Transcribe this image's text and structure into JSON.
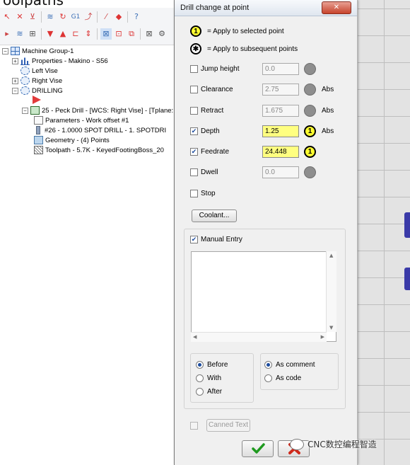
{
  "toolpaths": {
    "title": "oolpaths",
    "tree": [
      {
        "label": "Machine Group-1"
      },
      {
        "label": "Properties - Makino - S56"
      },
      {
        "label": "Left Vise"
      },
      {
        "label": "Right Vise"
      },
      {
        "label": "DRILLING"
      },
      {
        "label": "25 - Peck Drill - [WCS: Right Vise] - [Tplane:"
      },
      {
        "label": "Parameters - Work offset #1"
      },
      {
        "label": "#26 - 1.0000 SPOT DRILL - 1. SPOTDRI"
      },
      {
        "label": "Geometry - (4) Points"
      },
      {
        "label": "Toolpath - 5.7K - KeyedFootingBoss_20"
      }
    ],
    "toolbar_icons": [
      "select-icon",
      "deselect-icon",
      "filter-icon",
      "lock-icon",
      "regen-icon",
      "g1-icon",
      "post-icon",
      "help-icon",
      "toolpath-view-icon",
      "tool-icon",
      "move-down-icon",
      "move-up-icon",
      "insert-arrow-icon",
      "expand-icon",
      "select-all-icon",
      "copy-icon",
      "cut-icon",
      "tool-plane-icon",
      "gear-icon"
    ]
  },
  "dialog": {
    "title": "Drill change at point",
    "close_label": "✕",
    "legend": [
      {
        "symbol": "1",
        "text": "= Apply to selected point"
      },
      {
        "symbol": "✱",
        "text": "= Apply to subsequent points"
      }
    ],
    "params": [
      {
        "label": "Jump height",
        "value": "0.0",
        "checked": false,
        "abs": ""
      },
      {
        "label": "Clearance",
        "value": "2.75",
        "checked": false,
        "abs": "Abs"
      },
      {
        "label": "Retract",
        "value": "1.675",
        "checked": false,
        "abs": "Abs"
      },
      {
        "label": "Depth",
        "value": "1.25",
        "checked": true,
        "abs": "Abs"
      },
      {
        "label": "Feedrate",
        "value": "24.448",
        "checked": true,
        "abs": ""
      },
      {
        "label": "Dwell",
        "value": "0.0",
        "checked": false,
        "abs": ""
      }
    ],
    "stop_label": "Stop",
    "coolant_label": "Coolant...",
    "manual_entry_label": "Manual Entry",
    "manual_entry_value": "",
    "position_options": [
      "Before",
      "With",
      "After"
    ],
    "position_selected": "Before",
    "output_options": [
      "As comment",
      "As code"
    ],
    "output_selected": "As comment",
    "canned_text_label": "Canned Text",
    "ok_icon": "checkmark-icon",
    "cancel_icon": "red-x-icon",
    "accent_yellow": "#ffff80",
    "accent_green": "#1f9a1f",
    "accent_red": "#d02a1c"
  },
  "watermark": {
    "text": "CNC数控编程智造"
  }
}
